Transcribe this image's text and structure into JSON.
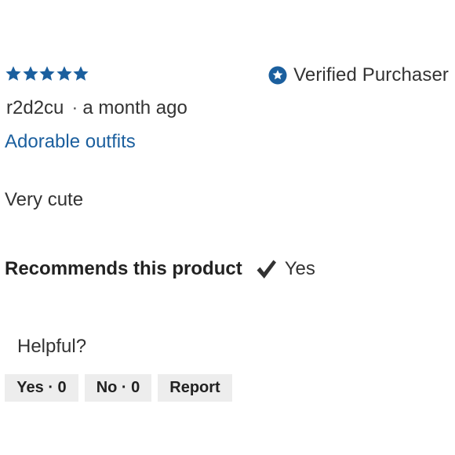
{
  "review": {
    "rating": 5,
    "rating_max": 5,
    "star_color": "#1b5f9e",
    "verified_label": "Verified Purchaser",
    "verified_icon": "star-badge-icon",
    "author": "r2d2cu",
    "separator": "·",
    "time_ago": "a month ago",
    "title": "Adorable outfits",
    "body": "Very cute",
    "recommends_label": "Recommends this product",
    "recommends_icon": "check-icon",
    "recommends_value": "Yes"
  },
  "feedback": {
    "helpful_label": "Helpful?",
    "yes_label": "Yes · 0",
    "no_label": "No · 0",
    "report_label": "Report"
  }
}
